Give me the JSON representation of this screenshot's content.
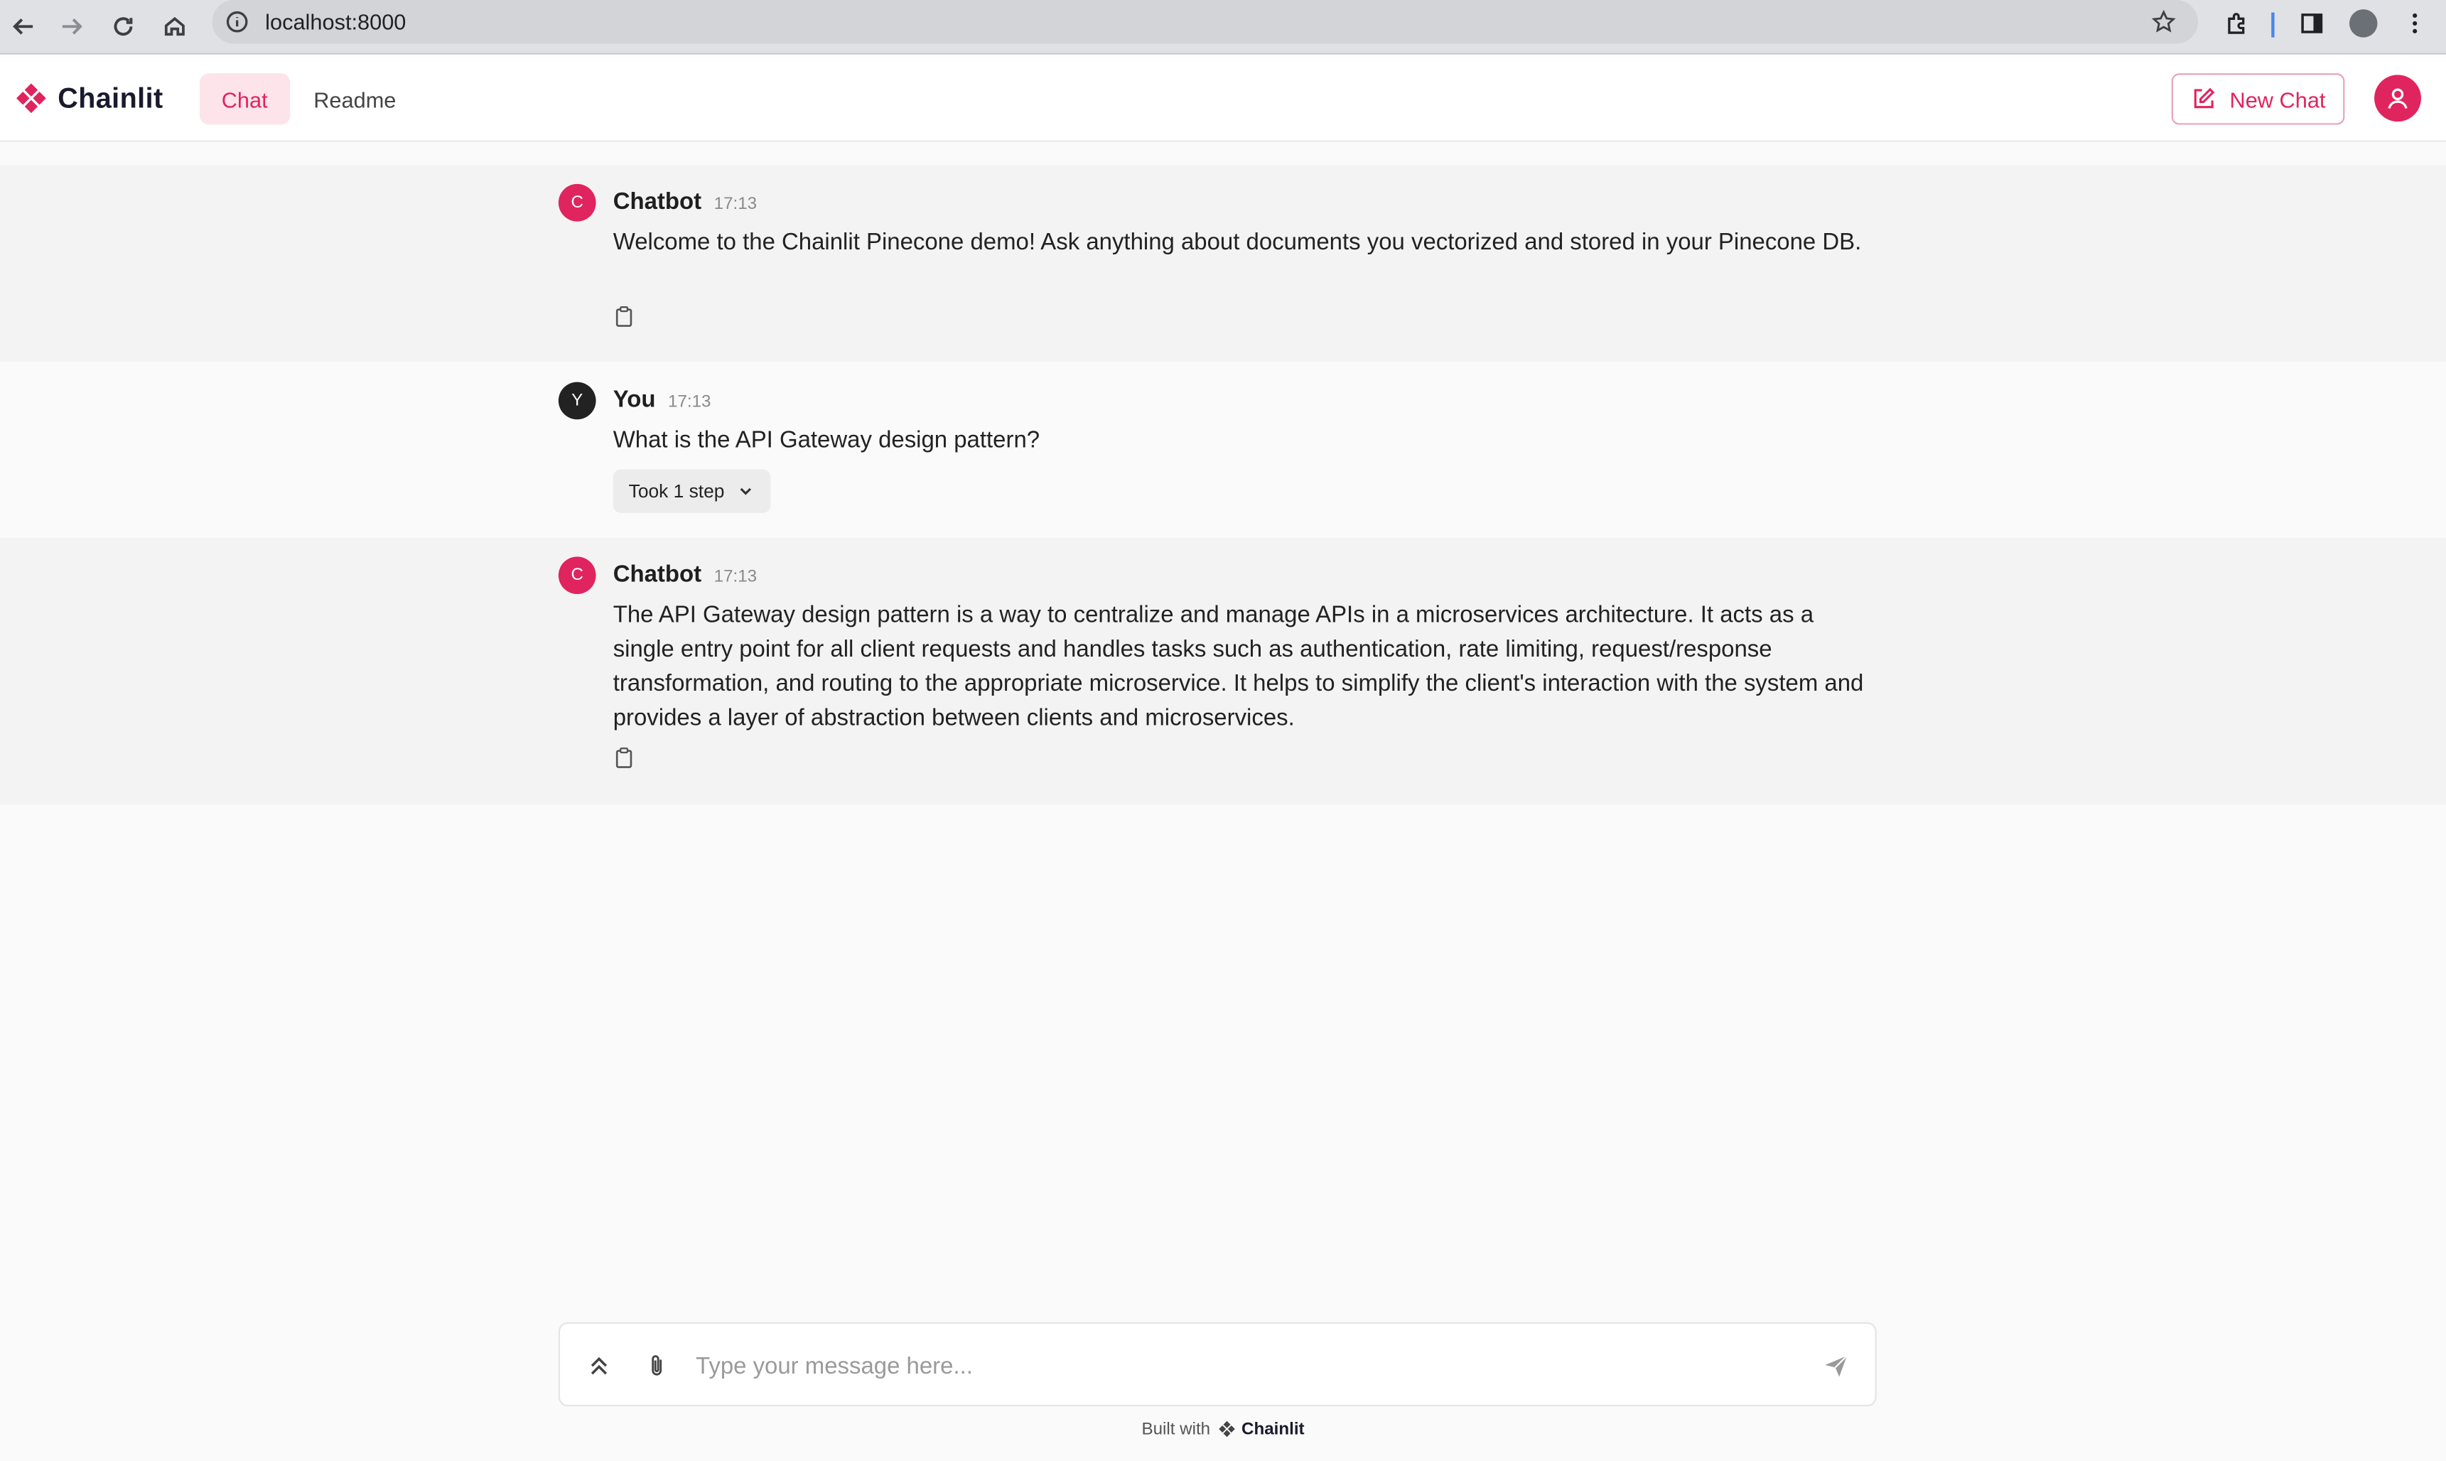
{
  "browser": {
    "url": "localhost:8000"
  },
  "header": {
    "brand": "Chainlit",
    "tabs": [
      {
        "label": "Chat",
        "active": true
      },
      {
        "label": "Readme",
        "active": false
      }
    ],
    "new_chat_label": "New Chat",
    "accent_color": "#e0245e"
  },
  "messages": [
    {
      "author": "Chatbot",
      "avatar_letter": "C",
      "time": "17:13",
      "text": "Welcome to the Chainlit Pinecone demo! Ask anything about documents you vectorized and stored in your Pinecone DB."
    },
    {
      "author": "You",
      "avatar_letter": "Y",
      "time": "17:13",
      "text": "What is the API Gateway design pattern?",
      "step_label": "Took 1 step"
    },
    {
      "author": "Chatbot",
      "avatar_letter": "C",
      "time": "17:13",
      "text": "The API Gateway design pattern is a way to centralize and manage APIs in a microservices architecture. It acts as a single entry point for all client requests and handles tasks such as authentication, rate limiting, request/response transformation, and routing to the appropriate microservice. It helps to simplify the client's interaction with the system and provides a layer of abstraction between clients and microservices."
    }
  ],
  "composer": {
    "placeholder": "Type your message here...",
    "value": ""
  },
  "footer": {
    "built_with": "Built with",
    "brand": "Chainlit"
  }
}
